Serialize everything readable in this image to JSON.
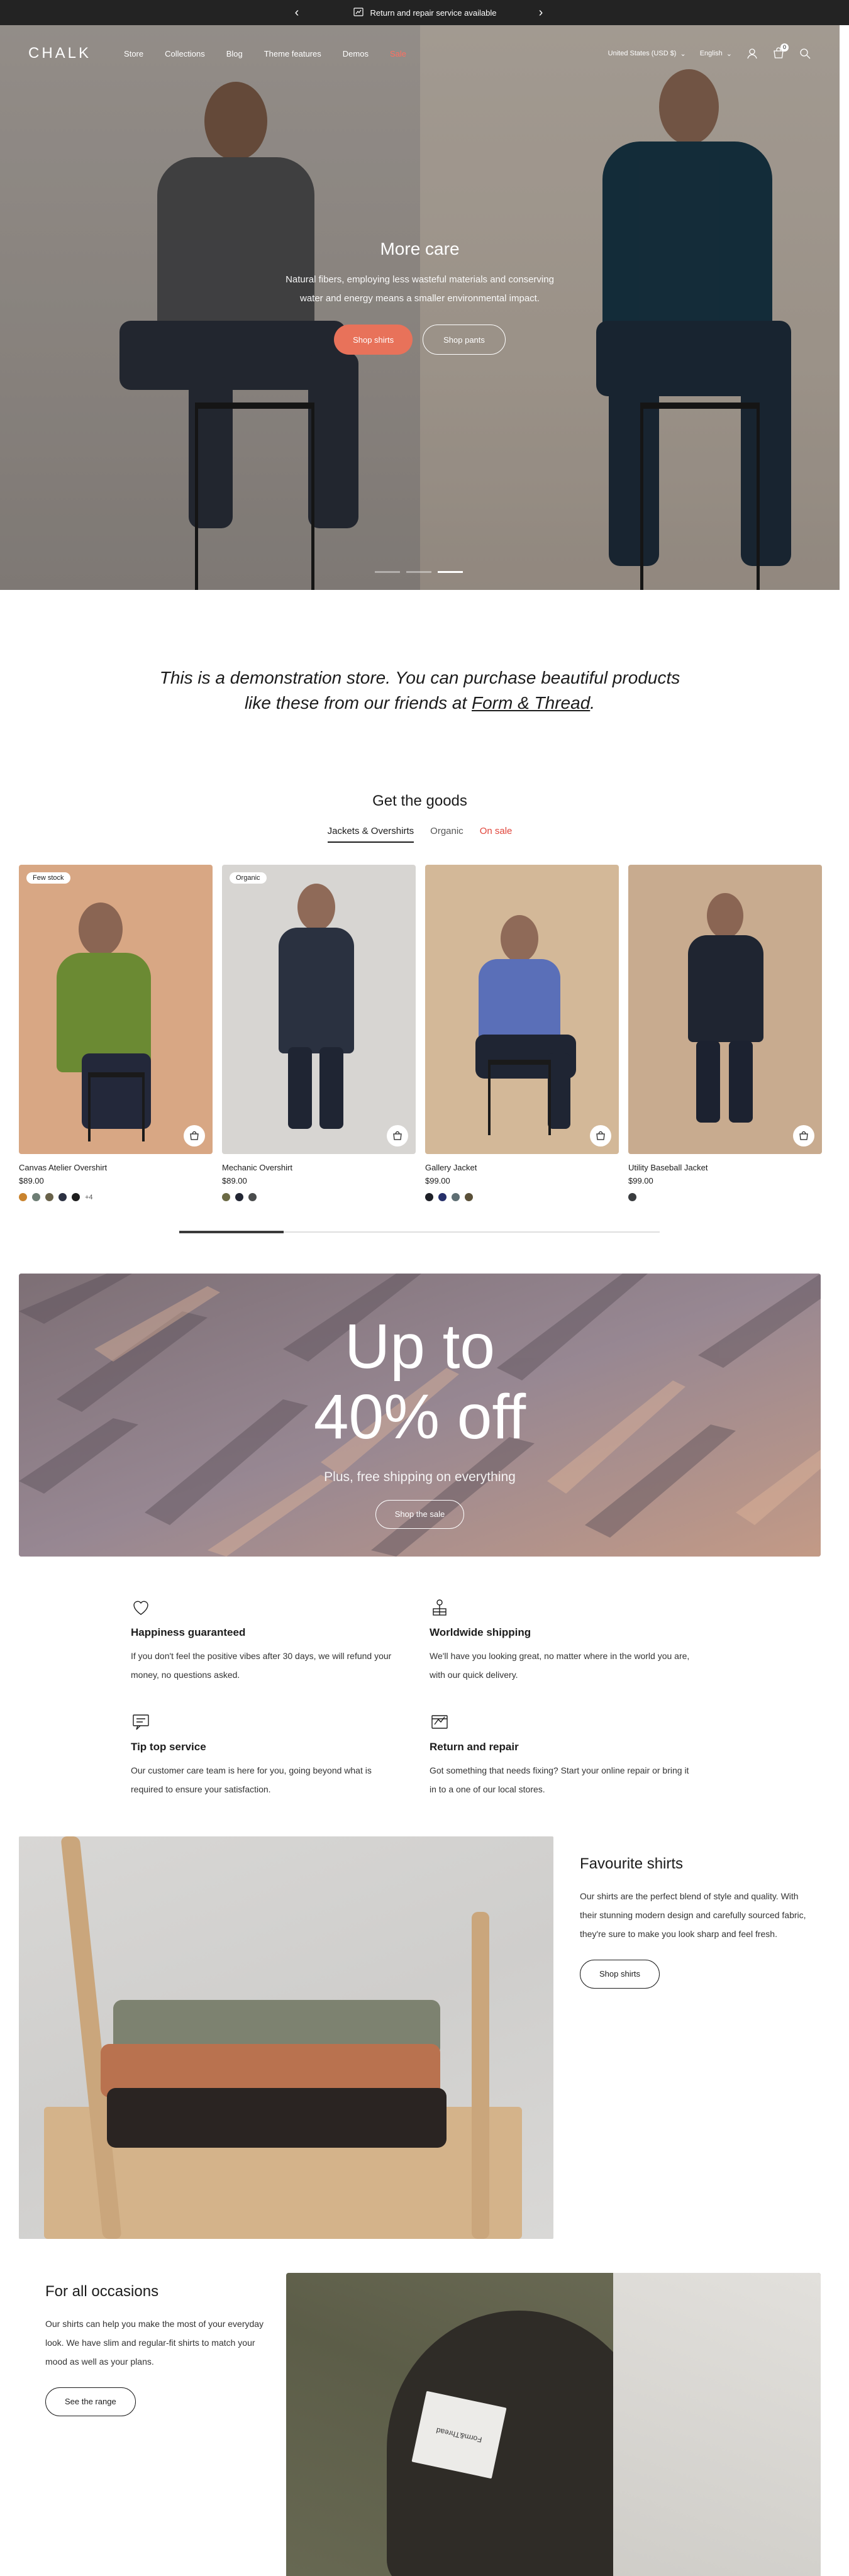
{
  "announcement": {
    "text": "Return and repair service available",
    "icon": "repair-icon"
  },
  "header": {
    "logo": "CHALK",
    "nav": [
      {
        "label": "Store"
      },
      {
        "label": "Collections"
      },
      {
        "label": "Blog"
      },
      {
        "label": "Theme features"
      },
      {
        "label": "Demos"
      },
      {
        "label": "Sale",
        "color": "#ff6f61"
      }
    ],
    "country": "United States (USD $)",
    "language": "English",
    "cart_count": "0"
  },
  "hero": {
    "title": "More care",
    "text": "Natural fibers, employing less wasteful materials and conserving water and energy means a smaller environmental impact.",
    "primary_button": "Shop shirts",
    "secondary_button": "Shop pants",
    "slides": 3,
    "active_slide": 3,
    "accent": "#e8725a"
  },
  "demo_notice": {
    "text": "This is a demonstration store. You can purchase beautiful products like these from our friends at",
    "link": "Form & Thread",
    "suffix": "."
  },
  "goods": {
    "title": "Get the goods",
    "tabs": [
      {
        "label": "Jackets & Overshirts",
        "active": true
      },
      {
        "label": "Organic",
        "active": false
      },
      {
        "label": "On sale",
        "active": false
      }
    ],
    "products": [
      {
        "badge": "Few stock",
        "name": "Canvas Atelier Overshirt",
        "price": "$89.00",
        "swatches": [
          "#c9832e",
          "#6d7d74",
          "#69624a",
          "#2c3142",
          "#1d1d1d"
        ],
        "more": "+4",
        "bg": "#d8a784",
        "garment": "#6b8a33"
      },
      {
        "badge": "Organic",
        "name": "Mechanic Overshirt",
        "price": "$89.00",
        "swatches": [
          "#6b6a45",
          "#222633",
          "#4a4c4d"
        ],
        "more": "",
        "bg": "#d7d5d2",
        "garment": "#2a3140"
      },
      {
        "badge": "",
        "name": "Gallery Jacket",
        "price": "$99.00",
        "swatches": [
          "#1d1f27",
          "#26306a",
          "#5e6e73",
          "#5a5038"
        ],
        "more": "",
        "bg": "#d3b898",
        "garment": "#5a6fb8"
      },
      {
        "badge": "",
        "name": "Utility Baseball Jacket",
        "price": "$99.00",
        "swatches": [
          "#3a3c3f"
        ],
        "more": "",
        "bg": "#c8ab8f",
        "garment": "#1f2531"
      }
    ]
  },
  "promo": {
    "headline_line1": "Up to",
    "headline_line2": "40% off",
    "subtext": "Plus, free shipping on everything",
    "button": "Shop the sale"
  },
  "features": [
    {
      "icon": "heart-icon",
      "title": "Happiness guaranteed",
      "text": "If you don't feel the positive vibes after 30 days, we will refund your money, no questions asked."
    },
    {
      "icon": "shipping-icon",
      "title": "Worldwide shipping",
      "text": "We'll have you looking great, no matter where in the world you are, with our quick delivery."
    },
    {
      "icon": "support-icon",
      "title": "Tip top service",
      "text": "Our customer care team is here for you, going beyond what is required to ensure your satisfaction."
    },
    {
      "icon": "repair-icon",
      "title": "Return and repair",
      "text": "Got something that needs fixing? Start your online repair or bring it in to a one of our local stores."
    }
  ],
  "favourite": {
    "title": "Favourite shirts",
    "text": "Our shirts are the perfect blend of style and quality. With their stunning modern design and carefully sourced fabric, they're sure to make you look sharp and feel fresh.",
    "button": "Shop shirts"
  },
  "occasions": {
    "title": "For all occasions",
    "text": "Our shirts can help you make the most of your everyday look. We have slim and regular-fit shirts to match your mood as well as your plans.",
    "button": "See the range",
    "label_text": "Form&Thread"
  }
}
